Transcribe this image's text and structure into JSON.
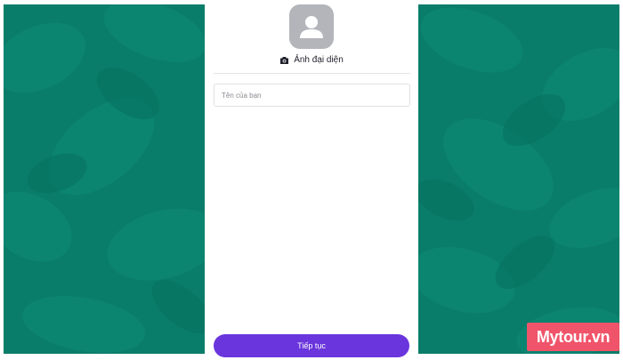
{
  "profile": {
    "avatar_icon": "user-placeholder-icon",
    "camera_icon": "camera-icon",
    "avatar_label": "Ảnh đại diện"
  },
  "form": {
    "name_placeholder": "Tên của bạn",
    "name_value": ""
  },
  "actions": {
    "continue_label": "Tiếp tục"
  },
  "watermark": {
    "text": "Mytour.vn"
  },
  "colors": {
    "background_green": "#0a7d6a",
    "button_purple": "#6a35dc",
    "avatar_gray": "#b3b5bb",
    "watermark_pink": "#f0546a"
  }
}
